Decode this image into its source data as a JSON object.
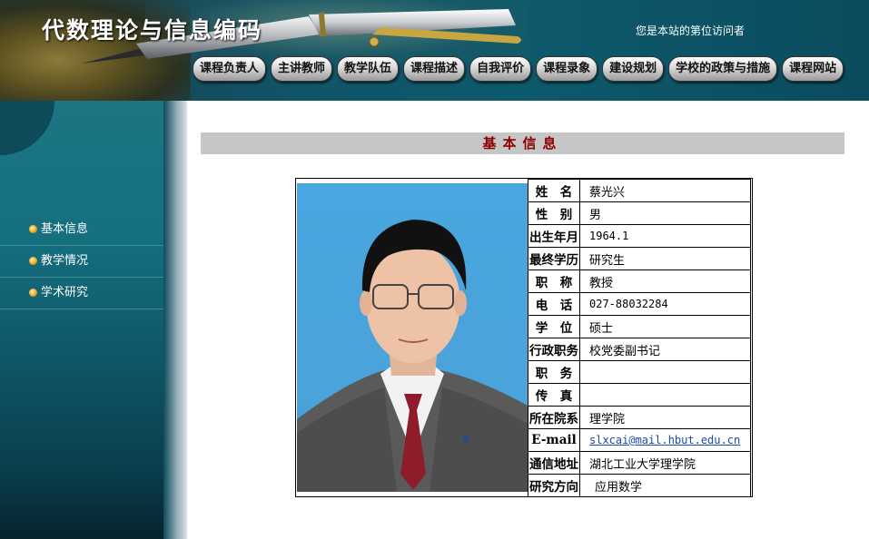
{
  "header": {
    "site_title": "代数理论与信息编码",
    "visitor_text": "您是本站的第位访问者"
  },
  "nav": {
    "items": [
      {
        "label": "课程负责人"
      },
      {
        "label": "主讲教师"
      },
      {
        "label": "教学队伍"
      },
      {
        "label": "课程描述"
      },
      {
        "label": "自我评价"
      },
      {
        "label": "课程录象"
      },
      {
        "label": "建设规划"
      },
      {
        "label": "学校的政策与措施"
      },
      {
        "label": "课程网站"
      }
    ]
  },
  "sidebar": {
    "items": [
      {
        "label": "基本信息"
      },
      {
        "label": "教学情况"
      },
      {
        "label": "学术研究"
      }
    ]
  },
  "main": {
    "section_title": "基本信息",
    "profile": {
      "rows": [
        {
          "key": "姓　名",
          "value": "蔡光兴"
        },
        {
          "key": "性　别",
          "value": "男"
        },
        {
          "key": "出生年月",
          "value": "1964.1"
        },
        {
          "key": "最终学历",
          "value": "研究生"
        },
        {
          "key": "职　称",
          "value": "教授"
        },
        {
          "key": "电　话",
          "value": "027-88032284"
        },
        {
          "key": "学　位",
          "value": "硕士"
        },
        {
          "key": "行政职务",
          "value": "校党委副书记"
        },
        {
          "key": "职　务",
          "value": ""
        },
        {
          "key": "传　真",
          "value": ""
        },
        {
          "key": "所在院系",
          "value": "理学院"
        },
        {
          "key": "E-mail",
          "value": "slxcai@mail.hbut.edu.cn"
        },
        {
          "key": "通信地址",
          "value": "湖北工业大学理学院"
        },
        {
          "key": "研究方向",
          "value": "应用数学"
        }
      ]
    }
  },
  "colors": {
    "header_bg": "#0d5a6c",
    "sidebar_bg": "#157080",
    "section_title": "#8b0000",
    "section_bar_bg": "#c6c6c6",
    "link": "#1a4aa8"
  },
  "icons": {
    "sidebar_bullet": "orange-bullet-icon",
    "header_art": "fountain-pen-icon"
  }
}
